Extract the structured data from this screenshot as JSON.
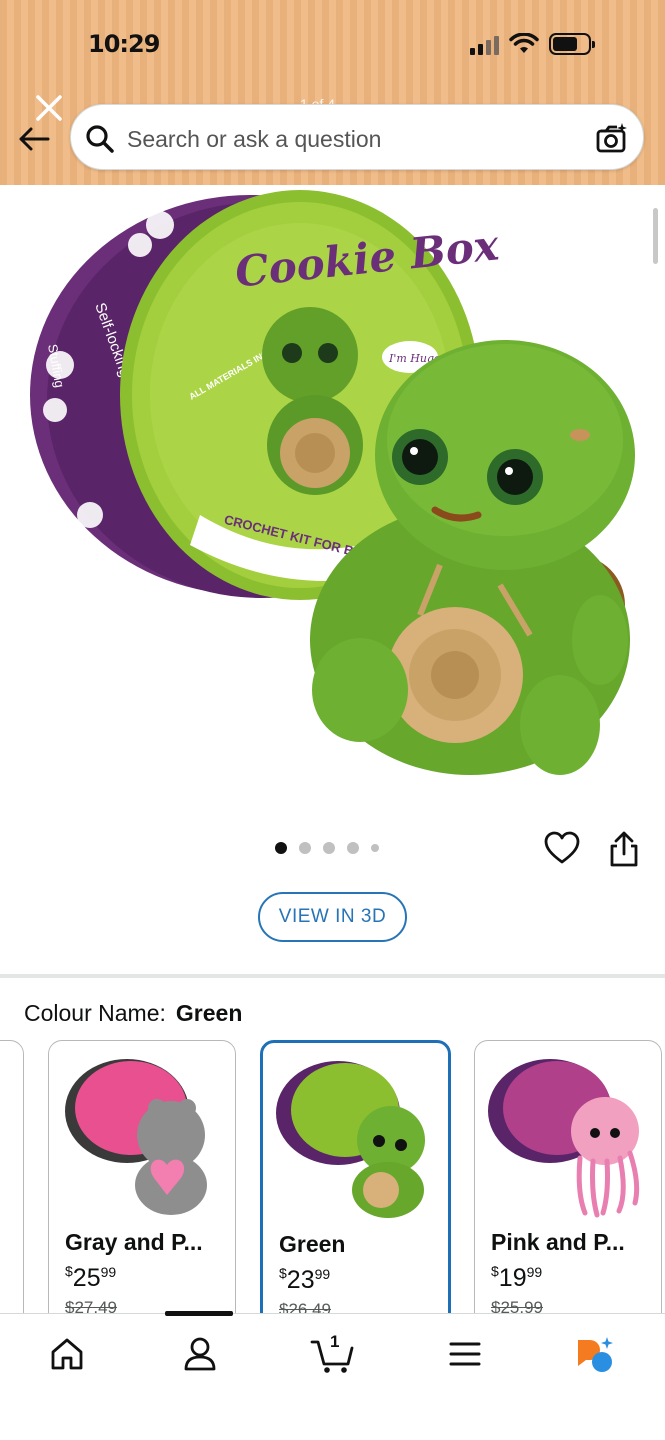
{
  "status_bar": {
    "time": "10:29"
  },
  "header": {
    "page_counter": "1 of 4",
    "search_placeholder": "Search or ask a question"
  },
  "product": {
    "image_alt": "Cookie Box turtle crochet kit",
    "tin_brand": "Cookie Box",
    "tin_tagline": "CROCHET KIT FOR BEGINN",
    "tin_note": "I'm Hugo",
    "tin_side_1": "Self-locking eyes",
    "tin_side_2": "Stuffing",
    "tin_badge": "ALL MATERIALS INCLUDED",
    "carousel_total": 5,
    "carousel_active": 0,
    "view_3d_label": "VIEW IN 3D"
  },
  "colour": {
    "label": "Colour Name:",
    "selected": "Green"
  },
  "variants": [
    {
      "name": "Gray and P...",
      "price_symbol": "$",
      "price_whole": "25",
      "price_cents": "99",
      "was": "$27.49",
      "selected": false,
      "tin_color": "#e8508f",
      "toy_color": "#8e8e8e"
    },
    {
      "name": "Green",
      "price_symbol": "$",
      "price_whole": "23",
      "price_cents": "99",
      "was": "$26.49",
      "selected": true,
      "tin_color": "#7fae2e",
      "toy_color": "#5ea02a"
    },
    {
      "name": "Pink and P...",
      "price_symbol": "$",
      "price_whole": "19",
      "price_cents": "99",
      "was": "$25.99",
      "selected": false,
      "tin_color": "#b0408a",
      "toy_color": "#f2a0c0"
    }
  ],
  "bottom_nav": {
    "cart_count": "1",
    "items": [
      "home",
      "account",
      "cart",
      "menu",
      "rufus"
    ]
  },
  "colors": {
    "header_tan": "#e8b07a",
    "accent_blue": "#2774b6",
    "selected_border": "#1d6fb8",
    "rufus_orange": "#f47b20",
    "rufus_blue": "#2a8fe0"
  }
}
